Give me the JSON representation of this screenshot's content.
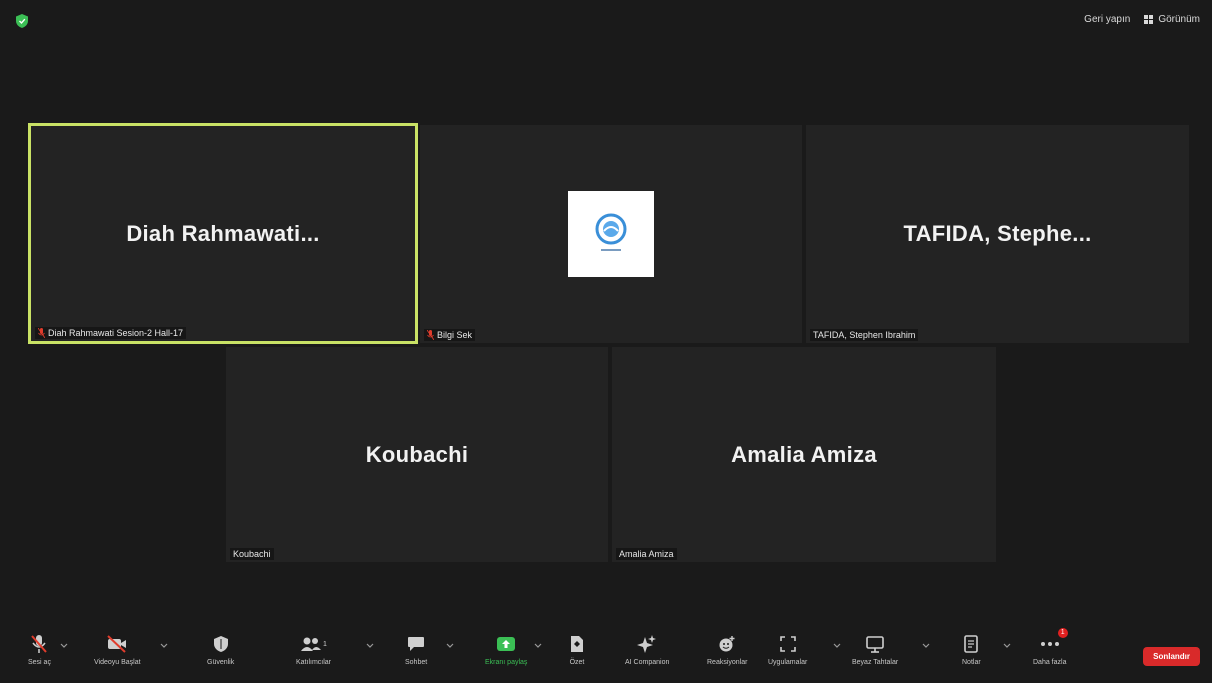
{
  "top_bar": {
    "view_button_label": "Görünüm",
    "exit_fullscreen_label": "Geri yapın"
  },
  "tiles": [
    {
      "big_name": "Diah Rahmawati...",
      "label": "Diah Rahmawati Sesion-2 Hall-17",
      "muted": true,
      "active": true
    },
    {
      "big_name": "",
      "label": "Bilgi Sek",
      "muted": true,
      "has_logo": true
    },
    {
      "big_name": "TAFIDA, Stephe...",
      "label": "TAFIDA, Stephen Ibrahim",
      "muted": false
    },
    {
      "big_name": "Koubachi",
      "label": "Koubachi",
      "muted": false
    },
    {
      "big_name": "Amalia Amiza",
      "label": "Amalia Amiza",
      "muted": false
    }
  ],
  "toolbar": {
    "items": [
      {
        "label": "Sesi aç",
        "icon": "mic-off-icon"
      },
      {
        "label": "Videoyu Başlat",
        "icon": "video-off-icon"
      },
      {
        "label": "Güvenlik",
        "icon": "shield-icon"
      },
      {
        "label": "Katılımcılar",
        "icon": "participants-icon",
        "count": "1"
      },
      {
        "label": "Sohbet",
        "icon": "chat-icon"
      },
      {
        "label": "Ekranı paylaş",
        "icon": "share-screen-icon"
      },
      {
        "label": "Özet",
        "icon": "summary-icon"
      },
      {
        "label": "AI Companion",
        "icon": "ai-companion-icon"
      },
      {
        "label": "Reaksiyonlar",
        "icon": "reactions-icon"
      },
      {
        "label": "Uygulamalar",
        "icon": "apps-icon"
      },
      {
        "label": "Beyaz Tahtalar",
        "icon": "whiteboard-icon"
      },
      {
        "label": "Notlar",
        "icon": "notes-icon"
      },
      {
        "label": "Daha fazla",
        "icon": "more-icon",
        "badge": "1"
      }
    ],
    "end_label": "Sonlandır"
  },
  "colors": {
    "active_speaker_border": "#c9e265",
    "share_green": "#3bbf55",
    "end_red": "#d92a2a",
    "mute_red": "#e03c2c"
  }
}
